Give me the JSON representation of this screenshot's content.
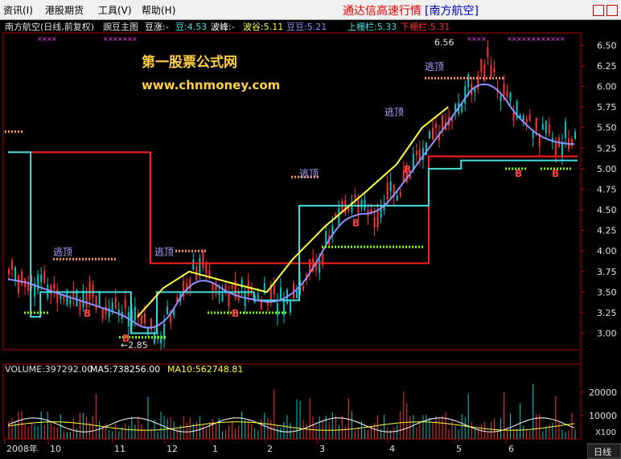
{
  "menu": {
    "items": [
      "资讯(I)",
      "港股期货",
      "工具(V)",
      "帮助(H)"
    ],
    "app_title": "通达信高速行情",
    "stock_tag": "[南方航空]"
  },
  "header": {
    "name": "南方航空(日线,前复权)",
    "indicator": "豌豆主图",
    "doudou_rise": "豆涨:-",
    "dou": "豆:4.53",
    "bofeng": "波峰:-",
    "bogu": "波谷:5.11",
    "doudou": "豆豆:5.21",
    "upper_rail": "上栅栏:5.33",
    "lower_rail": "下栅栏:5.31"
  },
  "watermark": {
    "line1": "第一股票公式网",
    "line2": "www.chnmoney.com"
  },
  "annotations": {
    "high": "6.56",
    "low": "←2.85",
    "escape_top": "逃顶",
    "buy": "B"
  },
  "volume_header": {
    "volume": "VOLUME:397292.00",
    "ma5": "MA5:738256.00",
    "ma10": "MA10:562748.81"
  },
  "volume_unit": "X100",
  "period_tab": "日线",
  "date_year": "2008年",
  "colors": {
    "up": "#ff3030",
    "down": "#00c8c8",
    "red_line": "#ff2020",
    "cyan_line": "#40e0e0",
    "purple_line": "#9090ff",
    "yellow_line": "#ffff40",
    "magenta": "#ff40ff",
    "green_dots": "#80ff00",
    "axis": "#b00000"
  },
  "chart_data": {
    "type": "candlestick",
    "price_axis": {
      "ticks": [
        "6.50",
        "6.25",
        "6.00",
        "5.75",
        "5.50",
        "5.25",
        "5.00",
        "4.75",
        "4.50",
        "4.25",
        "4.00",
        "3.75",
        "3.50",
        "3.25",
        "3.00"
      ],
      "ylim": [
        2.8,
        6.65
      ]
    },
    "volume_axis": {
      "ticks": [
        "20000",
        "10000"
      ],
      "ylim": [
        0,
        32000
      ]
    },
    "x_labels": [
      "2008年",
      "10",
      "11",
      "12",
      "1",
      "2",
      "3",
      "4",
      "5",
      "6"
    ],
    "price_high": 6.56,
    "price_low": 2.85,
    "series_notes": [
      "red stepped line",
      "cyan stepped line",
      "purple moving average",
      "yellow rising line"
    ]
  }
}
